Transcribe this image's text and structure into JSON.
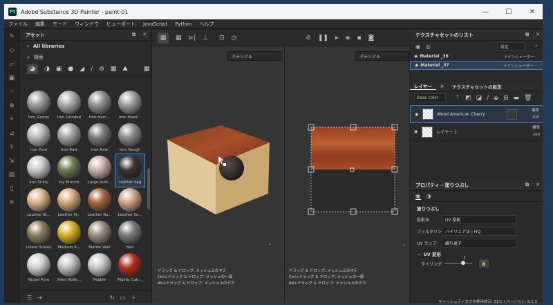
{
  "window": {
    "title": "Adobe Substance 3D Painter - paint-01",
    "logo": "Pt"
  },
  "menu": [
    "ファイル",
    "編集",
    "モード",
    "ウィンドウ",
    "ビューポート",
    "JavaScript",
    "Python",
    "ヘルプ"
  ],
  "assets": {
    "title": "アセット",
    "library": "All libraries",
    "search": "検索",
    "items": [
      {
        "label": "Iron Grainy",
        "color": "#9a9a9a"
      },
      {
        "label": "Iron Grinded",
        "color": "#a8a8a8"
      },
      {
        "label": "Iron Ham...",
        "color": "#8f8f8f"
      },
      {
        "label": "Iron Powd...",
        "color": "#9d9d9d"
      },
      {
        "label": "Iron Pure",
        "color": "#b8b8b8"
      },
      {
        "label": "Iron Raw",
        "color": "#a0a0a0"
      },
      {
        "label": "Iron Raw",
        "color": "#7b7b7b"
      },
      {
        "label": "Iron Rough",
        "color": "#8b8b8b"
      },
      {
        "label": "Iron Shiny",
        "color": "#c9c9c9"
      },
      {
        "label": "Ivy Branch",
        "color": "#6e7a50"
      },
      {
        "label": "Large Rust...",
        "color": "#c9b0a8"
      },
      {
        "label": "Leather bag",
        "color": "#3b3533"
      },
      {
        "label": "Leather Bi...",
        "color": "#d8b28a"
      },
      {
        "label": "Leather M...",
        "color": "#d4a878"
      },
      {
        "label": "Leather Ro...",
        "color": "#a0663e"
      },
      {
        "label": "Leather So...",
        "color": "#cfa583"
      },
      {
        "label": "Lizard Scales",
        "color": "#8a8060"
      },
      {
        "label": "Medium A...",
        "color": "#d6b020"
      },
      {
        "label": "Mortar Wall",
        "color": "#9a8a7a"
      },
      {
        "label": "Nail",
        "color": "#7a7a7a"
      },
      {
        "label": "Nickel Pure",
        "color": "#d0d0d0"
      },
      {
        "label": "Paint Rolle...",
        "color": "#bfbfbf"
      },
      {
        "label": "Pebble",
        "color": "#c8c8c8"
      },
      {
        "label": "Plastic Cab...",
        "color": "#b03020"
      },
      {
        "label": "",
        "color": "#2a2a2a"
      },
      {
        "label": "",
        "color": "#e0b020"
      },
      {
        "label": "",
        "color": "#d8a018"
      },
      {
        "label": "",
        "color": "#2090e0"
      }
    ]
  },
  "viewport": {
    "left_dropdown": "マテリアル",
    "right_dropdown": "マテリアル",
    "hints_left": [
      "ドラッグ & ドロップ: メッシュ上のマテ",
      "Ctrl+ドラッグ & ドロップ: メッシュの一部",
      "Alt+ドラッグ & ドロップ: メッシュ上のデカ"
    ],
    "hints_right": [
      "ドラッグ & ドロップ: メッシュ上のマテ",
      "Ctrl+ドラッグ & ドロップ: メッシュの一部",
      "Alt+ドラッグ & ドロップ: メッシュ上のデカ"
    ]
  },
  "texture_sets": {
    "title": "テクスチャセットのリスト",
    "settings": "設定",
    "rows": [
      {
        "name": "Material _36",
        "shader": "メインシェーダー"
      },
      {
        "name": "Material _37",
        "shader": "メインシェーダー"
      }
    ]
  },
  "layers": {
    "tab_layers": "レイヤー",
    "tab_texset": "テクスチャセットの設定",
    "channel": "Base color",
    "items": [
      {
        "name": "Wood American Cherry",
        "blend": "標準",
        "opacity": "100"
      },
      {
        "name": "レイヤー 1",
        "blend": "標準",
        "opacity": "100"
      }
    ]
  },
  "properties": {
    "title": "プロパティ - 塗りつぶし",
    "section": "塗りつぶし",
    "rows": [
      {
        "label": "投影法",
        "value": "UV 投影"
      },
      {
        "label": "フィルタリング",
        "value": "バイリニア法 | HQ"
      },
      {
        "label": "UV ラップ",
        "value": "繰り返す"
      }
    ],
    "uv_section": "UV 変形",
    "tiling_label": "タイリング",
    "tiling_value": "1"
  },
  "status": "キャッシュディスクの使用状況:  31% | バージョン: 8.1.3"
}
